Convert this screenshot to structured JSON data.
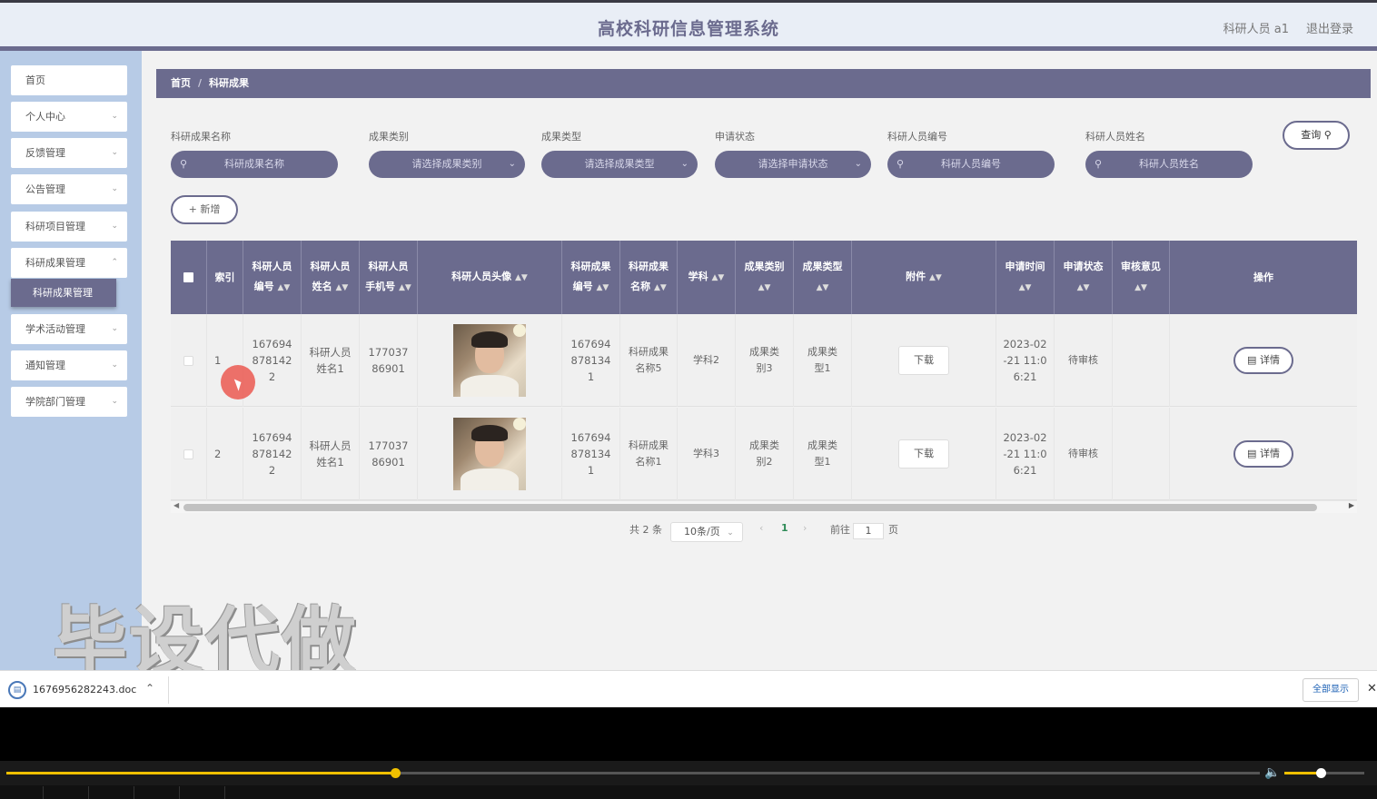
{
  "header": {
    "title": "高校科研信息管理系统",
    "user": "科研人员 a1",
    "logout": "退出登录"
  },
  "sidebar": {
    "items": [
      {
        "label": "首页",
        "chevron": false
      },
      {
        "label": "个人中心",
        "chevron": true
      },
      {
        "label": "反馈管理",
        "chevron": true
      },
      {
        "label": "公告管理",
        "chevron": true
      },
      {
        "label": "科研项目管理",
        "chevron": true
      },
      {
        "label": "科研成果管理",
        "chevron": true
      },
      {
        "label": "学术活动管理",
        "chevron": true
      },
      {
        "label": "通知管理",
        "chevron": true
      },
      {
        "label": "学院部门管理",
        "chevron": true
      }
    ],
    "active_sub": "科研成果管理"
  },
  "breadcrumb": {
    "home": "首页",
    "sep": "/",
    "current": "科研成果"
  },
  "filters": [
    {
      "label": "科研成果名称",
      "placeholder": "科研成果名称",
      "type": "search"
    },
    {
      "label": "成果类别",
      "placeholder": "请选择成果类别",
      "type": "select"
    },
    {
      "label": "成果类型",
      "placeholder": "请选择成果类型",
      "type": "select"
    },
    {
      "label": "申请状态",
      "placeholder": "请选择申请状态",
      "type": "select"
    },
    {
      "label": "科研人员编号",
      "placeholder": "科研人员编号",
      "type": "search"
    },
    {
      "label": "科研人员姓名",
      "placeholder": "科研人员姓名",
      "type": "search"
    }
  ],
  "buttons": {
    "query": "查询",
    "add": "新增",
    "download": "下载",
    "detail": "详情"
  },
  "table": {
    "columns": [
      "索引",
      "科研人员编号",
      "科研人员姓名",
      "科研人员手机号",
      "科研人员头像",
      "科研成果编号",
      "科研成果名称",
      "学科",
      "成果类别",
      "成果类型",
      "附件",
      "申请时间",
      "申请状态",
      "审核意见",
      "操作"
    ],
    "rows": [
      {
        "index": "1",
        "staff_no": "1676948781422",
        "staff_name": "科研人员姓名1",
        "phone": "17703786901",
        "result_no": "1676948781341",
        "result_name": "科研成果名称5",
        "subject": "学科2",
        "category": "成果类别3",
        "type": "成果类型1",
        "time": "2023-02-21 11:06:21",
        "status": "待审核",
        "opinion": ""
      },
      {
        "index": "2",
        "staff_no": "1676948781422",
        "staff_name": "科研人员姓名1",
        "phone": "17703786901",
        "result_no": "1676948781341",
        "result_name": "科研成果名称1",
        "subject": "学科3",
        "category": "成果类别2",
        "type": "成果类型1",
        "time": "2023-02-21 11:06:21",
        "status": "待审核",
        "opinion": ""
      }
    ]
  },
  "pagination": {
    "total": "共 2 条",
    "page_size": "10条/页",
    "current": "1",
    "goto_label": "前往",
    "goto_value": "1",
    "page_suffix": "页"
  },
  "watermark": "毕设代做",
  "download_bar": {
    "filename": "1676956282243.doc",
    "show_all": "全部显示"
  },
  "player": {
    "progress": 0.31,
    "volume": 0.45
  },
  "colors": {
    "accent": "#6b6b8e",
    "sidebar_bg": "#b7cbe6",
    "active_page": "#2e8b57"
  }
}
